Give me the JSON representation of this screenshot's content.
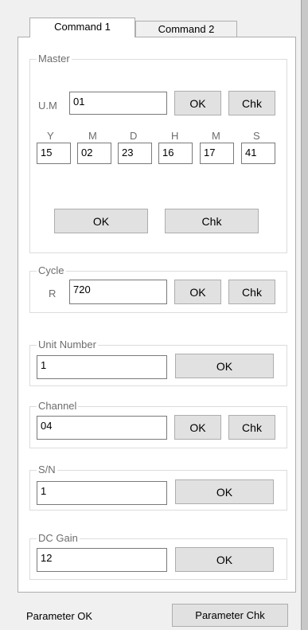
{
  "tabs": [
    "Command 1",
    "Command 2"
  ],
  "master": {
    "legend": "Master",
    "um_label": "U.M",
    "um_value": "01",
    "ok": "OK",
    "chk": "Chk",
    "date_labels": [
      "Y",
      "M",
      "D",
      "H",
      "M",
      "S"
    ],
    "date_values": [
      "15",
      "02",
      "23",
      "16",
      "17",
      "41"
    ],
    "date_ok": "OK",
    "date_chk": "Chk"
  },
  "cycle": {
    "legend": "Cycle",
    "r_label": "R",
    "value": "720",
    "ok": "OK",
    "chk": "Chk"
  },
  "unit_number": {
    "legend": "Unit Number",
    "value": "1",
    "ok": "OK"
  },
  "channel": {
    "legend": "Channel",
    "value": "04",
    "ok": "OK",
    "chk": "Chk"
  },
  "sn": {
    "legend": "S/N",
    "value": "1",
    "ok": "OK"
  },
  "dc_gain": {
    "legend": "DC Gain",
    "value": "12",
    "ok": "OK"
  },
  "footer": {
    "status": "Parameter OK",
    "check_button": "Parameter Chk"
  }
}
